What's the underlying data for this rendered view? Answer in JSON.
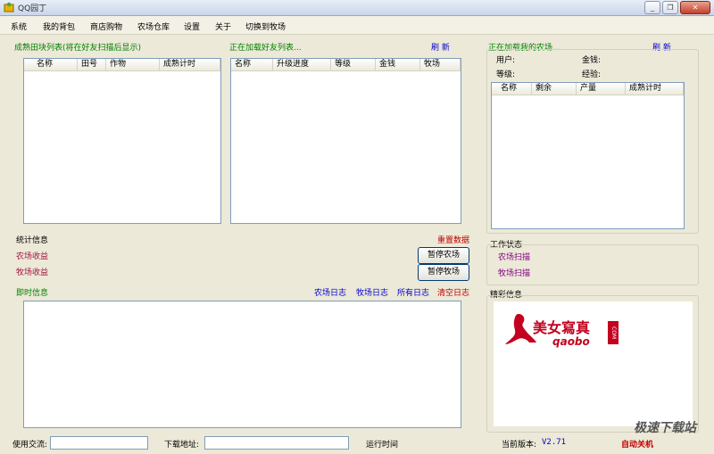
{
  "window": {
    "title": "QQ园丁",
    "minimize_glyph": "_",
    "restore_glyph": "❐",
    "close_glyph": "✕"
  },
  "menu": [
    "系统",
    "我的背包",
    "商店购物",
    "农场仓库",
    "设置",
    "关于",
    "切换到牧场"
  ],
  "panel_mature": {
    "title": "成熟田块列表(将在好友扫描后显示)",
    "columns": [
      "名称",
      "田号",
      "作物",
      "成熟计时"
    ]
  },
  "panel_friends": {
    "title": "正在加载好友列表...",
    "refresh": "刷 新",
    "columns": [
      "名称",
      "升级进度",
      "等级",
      "金钱",
      "牧场"
    ]
  },
  "panel_my_farm": {
    "title": "正在加载我的农场...",
    "refresh": "刷 新",
    "user_label": "用户:",
    "money_label": "金钱:",
    "level_label": "等级:",
    "exp_label": "经验:",
    "columns": [
      "名称",
      "剩余",
      "产量",
      "成熟计时"
    ]
  },
  "stats": {
    "title": "统计信息",
    "reset": "重置数据",
    "farm_income": "农场收益",
    "ranch_income": "牧场收益",
    "pause_farm": "暂停农场",
    "pause_ranch": "暂停牧场"
  },
  "work_status": {
    "title": "工作状态",
    "farm_scan": "农场扫描",
    "ranch_scan": "牧场扫描"
  },
  "log": {
    "title": "即时信息",
    "farm_log": "农场日志",
    "ranch_log": "牧场日志",
    "all_log": "所有日志",
    "clear_log": "清空日志"
  },
  "highlights": {
    "title": "精彩信息",
    "ad_text": "美女寫真",
    "ad_site": "qaobo",
    "ad_com": "COM"
  },
  "footer": {
    "exchange_label": "使用交流:",
    "exchange_value": "",
    "download_label": "下载地址:",
    "download_value": "",
    "runtime_label": "运行时间",
    "version_label": "当前版本:",
    "version_value": "V2.71",
    "auto_shutdown": "自动关机"
  },
  "watermark": "极速下载站",
  "colors": {
    "green": "#008000",
    "blue": "#0000cc",
    "red": "#c00000",
    "purple": "#800080"
  }
}
